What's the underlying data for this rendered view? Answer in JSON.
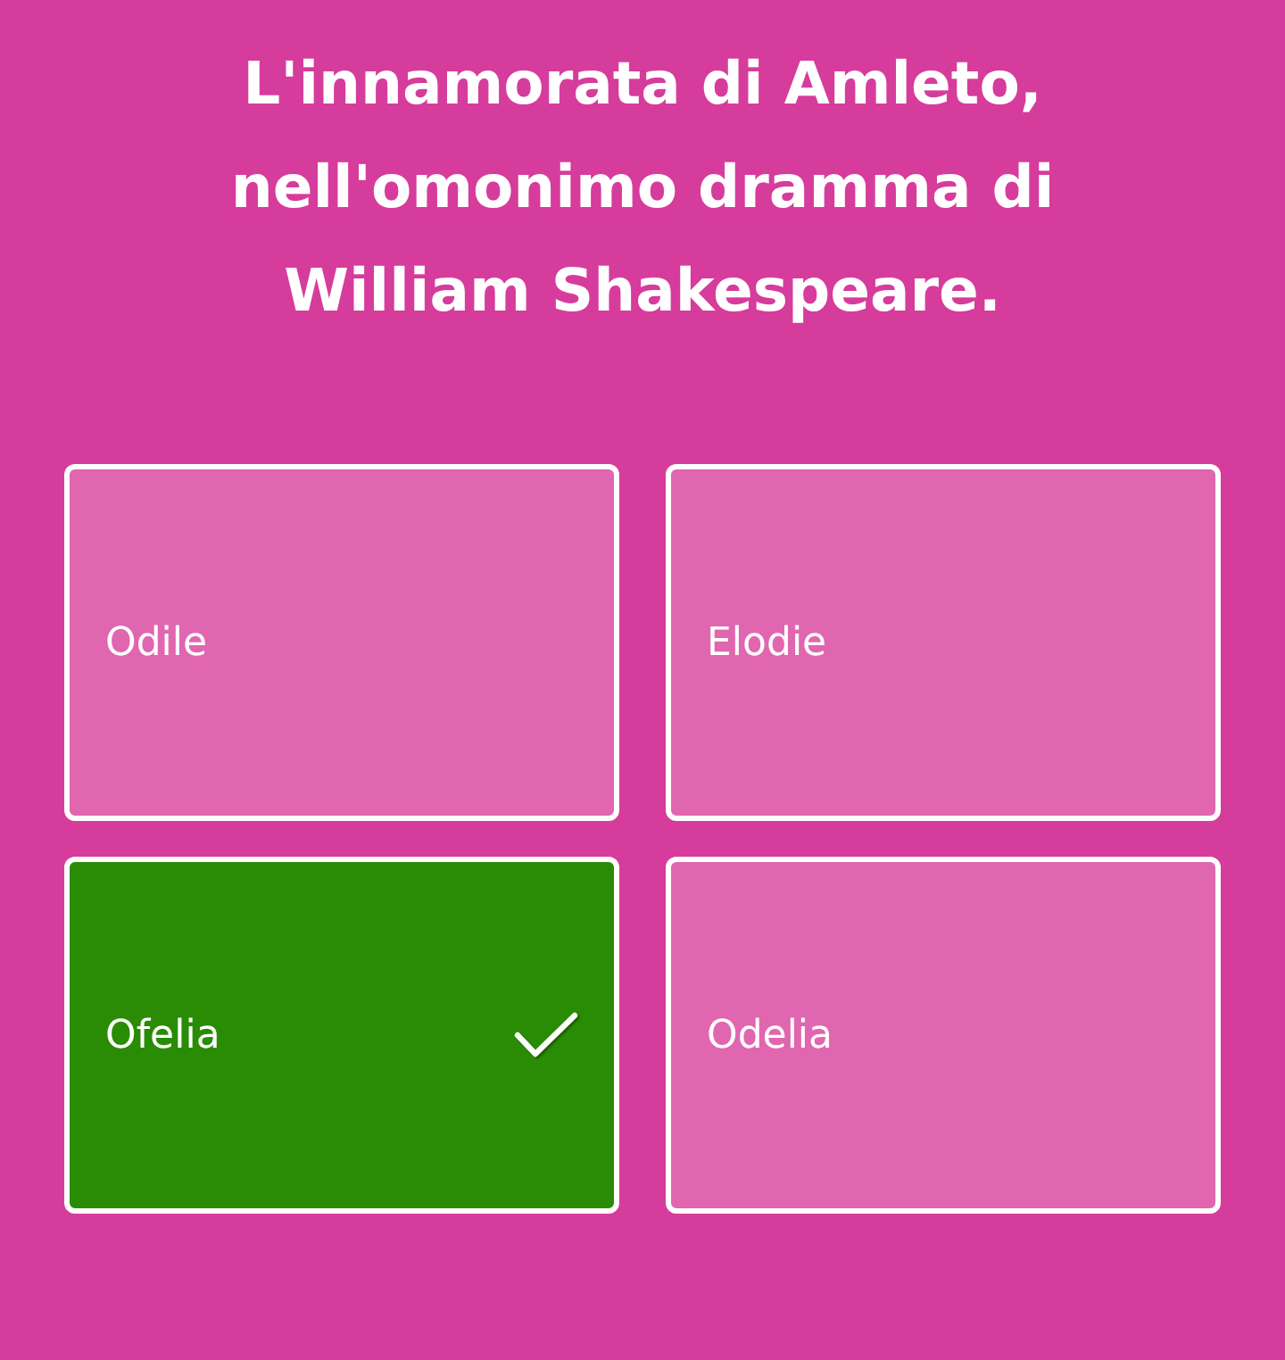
{
  "question": "L'innamorata di Amleto, nell'omonimo dramma di William Shakespeare.",
  "answers": [
    {
      "label": "Odile",
      "selected": false
    },
    {
      "label": "Elodie",
      "selected": false
    },
    {
      "label": "Ofelia",
      "selected": true
    },
    {
      "label": "Odelia",
      "selected": false
    }
  ]
}
